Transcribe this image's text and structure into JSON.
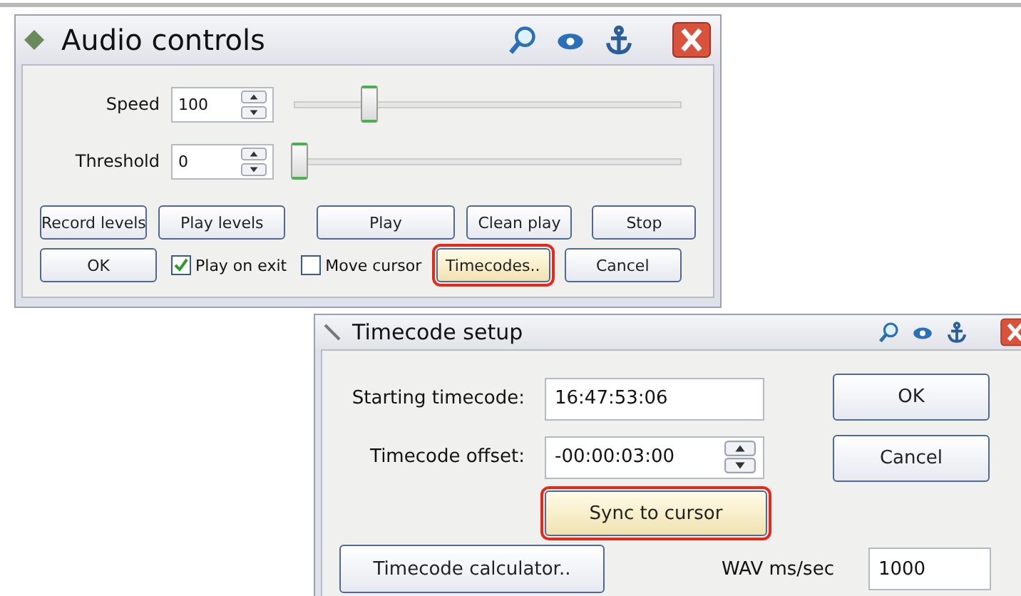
{
  "audio_controls": {
    "title": "Audio controls",
    "sliders": [
      {
        "label": "Speed",
        "value": "100",
        "level": 0.18
      },
      {
        "label": "Threshold",
        "value": "0",
        "level": 0
      }
    ],
    "buttons": [
      {
        "label": "Record levels",
        "highlighted": false
      },
      {
        "label": "Play levels",
        "highlighted": false
      },
      {
        "label": "Play",
        "highlighted": false
      },
      {
        "label": "Clean play",
        "highlighted": false
      },
      {
        "label": "Stop",
        "highlighted": false
      }
    ],
    "bottom_row": [
      {
        "kind": "button",
        "label": "OK",
        "highlighted": false
      },
      {
        "kind": "checkbox",
        "label": "Play on exit",
        "checked": true
      },
      {
        "kind": "checkbox",
        "label": "Move cursor",
        "checked": false
      },
      {
        "kind": "button",
        "label": "Timecodes..",
        "highlighted": true
      },
      {
        "kind": "button",
        "label": "Cancel",
        "highlighted": false
      }
    ]
  },
  "timecode_setup": {
    "title": "Timecode setup",
    "fields": [
      {
        "label": "Starting timecode:",
        "value": "16:47:53:06",
        "spinner": false
      },
      {
        "label": "Timecode offset:",
        "value": "-00:00:03:00",
        "spinner": true
      }
    ],
    "sync_button": {
      "label": "Sync to cursor",
      "highlighted": true
    },
    "side_buttons": [
      "OK",
      "Cancel"
    ],
    "calculator_button": "Timecode calculator..",
    "wav": {
      "label": "WAV ms/sec",
      "value": "1000"
    }
  }
}
